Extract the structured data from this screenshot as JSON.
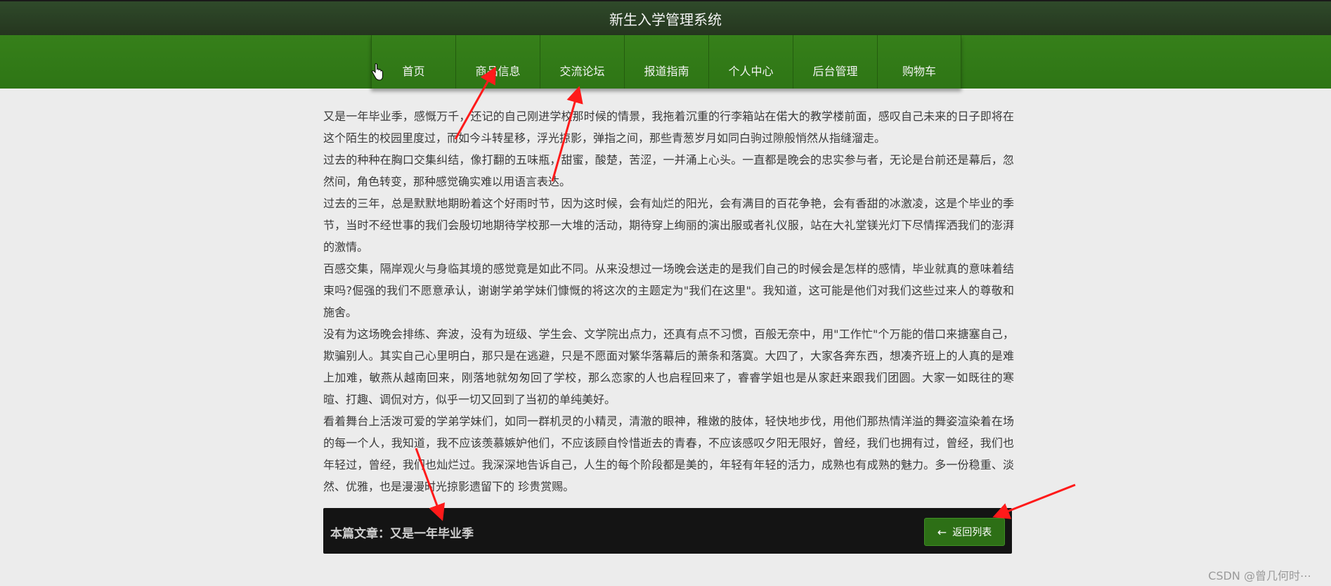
{
  "app": {
    "title": "新生入学管理系统"
  },
  "nav": {
    "items": [
      "首页",
      "商品信息",
      "交流论坛",
      "报道指南",
      "个人中心",
      "后台管理",
      "购物车"
    ]
  },
  "article": {
    "paragraphs": [
      "又是一年毕业季，感慨万千，还记的自己刚进学校那时候的情景，我拖着沉重的行李箱站在偌大的教学楼前面，感叹自己未来的日子即将在这个陌生的校园里度过，而如今斗转星移，浮光掠影，弹指之间，那些青葱岁月如同白驹过隙般悄然从指缝溜走。",
      "过去的种种在胸口交集纠结，像打翻的五味瓶，甜蜜，酸楚，苦涩，一并涌上心头。一直都是晚会的忠实参与者，无论是台前还是幕后，忽然间，角色转变，那种感觉确实难以用语言表达。",
      "过去的三年，总是默默地期盼着这个好雨时节，因为这时候，会有灿烂的阳光，会有满目的百花争艳，会有香甜的冰激凌，这是个毕业的季节，当时不经世事的我们会殷切地期待学校那一大堆的活动，期待穿上绚丽的演出服或者礼仪服，站在大礼堂镁光灯下尽情挥洒我们的澎湃的激情。",
      "百感交集，隔岸观火与身临其境的感觉竟是如此不同。从来没想过一场晚会送走的是我们自己的时候会是怎样的感情，毕业就真的意味着结束吗?倔强的我们不愿意承认，谢谢学弟学妹们慷慨的将这次的主题定为\"我们在这里\"。我知道，这可能是他们对我们这些过来人的尊敬和施舍。",
      "没有为这场晚会排练、奔波，没有为班级、学生会、文学院出点力，还真有点不习惯，百般无奈中，用\"工作忙\"个万能的借口来搪塞自己，欺骗别人。其实自己心里明白，那只是在逃避，只是不愿面对繁华落幕后的萧条和落寞。大四了，大家各奔东西，想凑齐班上的人真的是难上加难，敏燕从越南回来，刚落地就匆匆回了学校，那么恋家的人也启程回来了，睿睿学姐也是从家赶来跟我们团圆。大家一如既往的寒暄、打趣、调侃对方，似乎一切又回到了当初的单纯美好。",
      "看着舞台上活泼可爱的学弟学妹们，如同一群机灵的小精灵，清澈的眼神，稚嫩的肢体，轻快地步伐，用他们那热情洋溢的舞姿渲染着在场的每一个人，我知道，我不应该羡慕嫉妒他们，不应该顾自怜惜逝去的青春，不应该感叹夕阳无限好，曾经，我们也拥有过，曾经，我们也年轻过，曾经，我们也灿烂过。我深深地告诉自己，人生的每个阶段都是美的，年轻有年轻的活力，成熟也有成熟的魅力。多一份稳重、淡然、优雅，也是漫漫时光掠影遗留下的 珍贵赏赐。"
    ]
  },
  "footer": {
    "label": "本篇文章：",
    "article_title": "又是一年毕业季",
    "back_button": "返回列表",
    "back_icon": "arrow-left-icon"
  },
  "watermark": "CSDN @曾几何时⋯",
  "colors": {
    "title_bar": "#2f4a2a",
    "nav_bar": "#36801a",
    "back_button": "#2d6f16",
    "annotation_arrow": "#ff1a1a"
  }
}
